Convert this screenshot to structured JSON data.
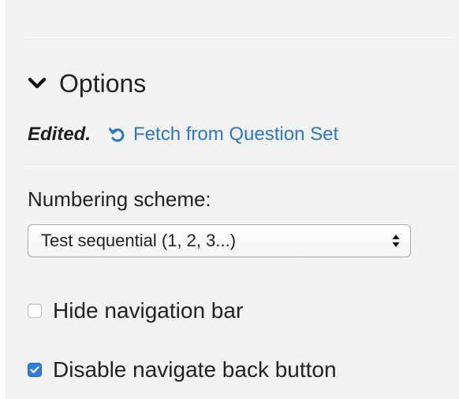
{
  "options_section": {
    "title": "Options",
    "edited_label": "Edited.",
    "fetch_link_label": "Fetch from Question Set"
  },
  "numbering": {
    "label": "Numbering scheme:",
    "selected_value": "Test sequential (1, 2, 3...)"
  },
  "checkboxes": {
    "hide_navigation_bar": {
      "label": "Hide navigation bar",
      "checked": false
    },
    "disable_navigate_back": {
      "label": "Disable navigate back button",
      "checked": true
    }
  },
  "colors": {
    "panel_background": "#f2f2f2",
    "link": "#2c78c4",
    "checkbox_checked": "#2f7fe0"
  },
  "icons": {
    "options_chevron": "chevron-down-icon",
    "fetch": "undo-arrow-icon",
    "select": "select-arrows-icon",
    "checkmark": "checkmark-icon"
  }
}
